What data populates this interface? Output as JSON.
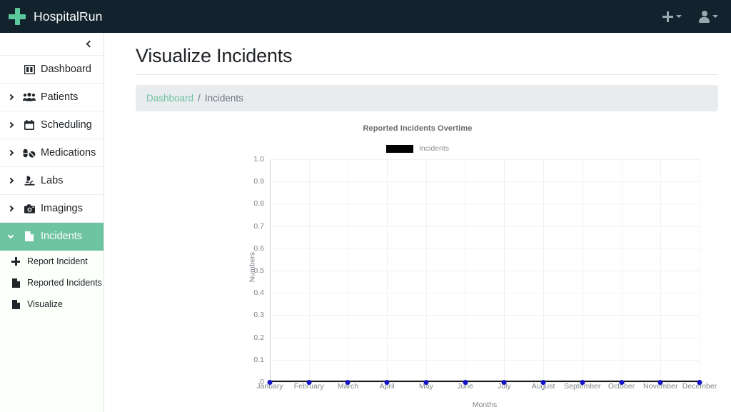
{
  "navbar": {
    "brand": "HospitalRun",
    "logo_icon": "cross-icon",
    "add_button": {
      "icon": "plus-icon",
      "has_caret": true
    },
    "user_button": {
      "icon": "person-icon",
      "has_caret": true
    }
  },
  "sidebar": {
    "collapse_icon": "chevron-left-icon",
    "items": [
      {
        "label": "Dashboard",
        "icon": "dashboard-icon",
        "expandable": false,
        "active": false
      },
      {
        "label": "Patients",
        "icon": "patients-icon",
        "expandable": true,
        "active": false
      },
      {
        "label": "Scheduling",
        "icon": "calendar-icon",
        "expandable": true,
        "active": false
      },
      {
        "label": "Medications",
        "icon": "pills-icon",
        "expandable": true,
        "active": false
      },
      {
        "label": "Labs",
        "icon": "microscope-icon",
        "expandable": true,
        "active": false
      },
      {
        "label": "Imagings",
        "icon": "camera-icon",
        "expandable": true,
        "active": false
      },
      {
        "label": "Incidents",
        "icon": "file-icon",
        "expandable": true,
        "active": true
      }
    ],
    "sub_items": [
      {
        "label": "Report Incident",
        "icon": "plus-icon"
      },
      {
        "label": "Reported Incidents",
        "icon": "file-icon"
      },
      {
        "label": "Visualize",
        "icon": "file-icon"
      }
    ]
  },
  "main": {
    "page_title": "Visualize Incidents",
    "breadcrumb": {
      "link": "Dashboard",
      "separator": "/",
      "current": "Incidents"
    }
  },
  "colors": {
    "navbar_bg": "#12232e",
    "accent_green": "#6ec3a0",
    "logo_green": "#5bc99b",
    "breadcrumb_bg": "#e9ecef",
    "marker_blue": "#1414c8",
    "legend_black": "#000000"
  },
  "chart_data": {
    "type": "line",
    "title": "Reported Incidents Overtime",
    "xlabel": "Months",
    "ylabel": "Numbers",
    "categories": [
      "January",
      "February",
      "March",
      "April",
      "May",
      "June",
      "July",
      "August",
      "September",
      "October",
      "November",
      "December"
    ],
    "series": [
      {
        "name": "Incidents",
        "color": "#000000",
        "marker_color": "#1414c8",
        "values": [
          0,
          0,
          0,
          0,
          0,
          0,
          0,
          0,
          0,
          0,
          0,
          0
        ]
      }
    ],
    "ylim": [
      0,
      1.0
    ],
    "yticks": [
      "0",
      "0.1",
      "0.2",
      "0.3",
      "0.4",
      "0.5",
      "0.6",
      "0.7",
      "0.8",
      "0.9",
      "1.0"
    ],
    "grid": true,
    "legend": {
      "position": "top",
      "entries": [
        "Incidents"
      ]
    }
  }
}
